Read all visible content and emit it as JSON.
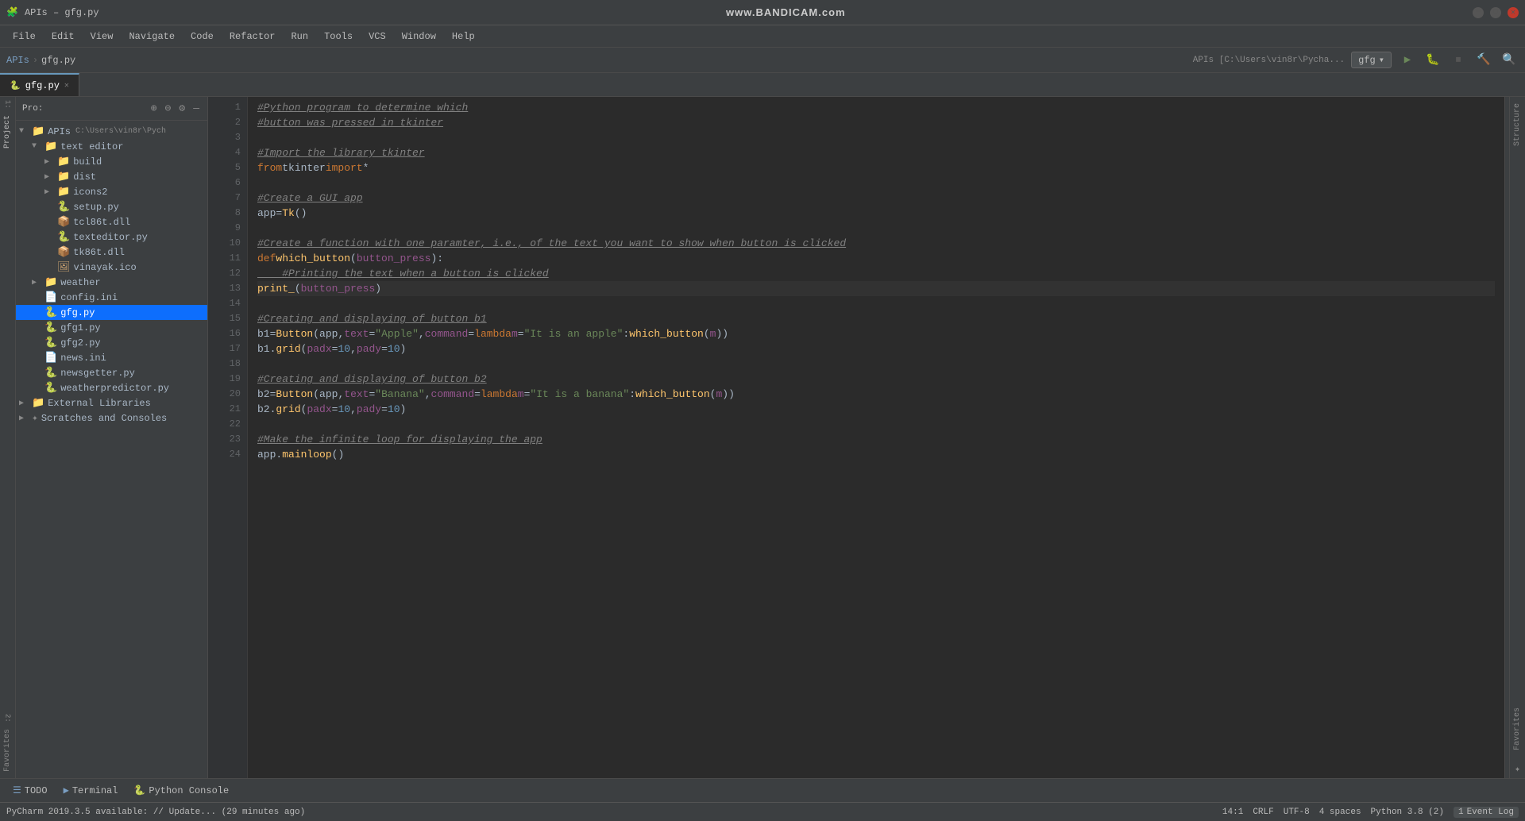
{
  "window": {
    "title": "APIs – gfg.py",
    "watermark": "www.BANDICAM.com"
  },
  "menubar": {
    "items": [
      "File",
      "Edit",
      "View",
      "Navigate",
      "Code",
      "Refactor",
      "Run",
      "Tools",
      "VCS",
      "Window",
      "Help"
    ]
  },
  "navbar": {
    "breadcrumb": [
      "APIs",
      "gfg.py"
    ],
    "run_config": "gfg",
    "path": "APIs [C:\\Users\\vin8r\\Pycha..."
  },
  "tabs": [
    {
      "label": "gfg.py",
      "active": true,
      "icon": "🐍"
    }
  ],
  "sidebar": {
    "title": "Pro:",
    "icons": [
      "⊕",
      "⊖",
      "⚙",
      "—"
    ],
    "tree": [
      {
        "level": 0,
        "type": "root",
        "label": "APIs",
        "sublabel": "C:\\Users\\vin8r\\Pych",
        "expanded": true,
        "arrow": "▼"
      },
      {
        "level": 1,
        "type": "folder",
        "label": "text editor",
        "expanded": true,
        "arrow": "▼"
      },
      {
        "level": 2,
        "type": "folder",
        "label": "build",
        "expanded": false,
        "arrow": "▶"
      },
      {
        "level": 2,
        "type": "folder",
        "label": "dist",
        "expanded": false,
        "arrow": "▶"
      },
      {
        "level": 2,
        "type": "folder",
        "label": "icons2",
        "expanded": false,
        "arrow": "▶"
      },
      {
        "level": 2,
        "type": "py",
        "label": "setup.py"
      },
      {
        "level": 2,
        "type": "dll",
        "label": "tcl86t.dll"
      },
      {
        "level": 2,
        "type": "py",
        "label": "texteditor.py"
      },
      {
        "level": 2,
        "type": "dll",
        "label": "tk86t.dll"
      },
      {
        "level": 2,
        "type": "ico",
        "label": "vinayak.ico"
      },
      {
        "level": 1,
        "type": "folder",
        "label": "weather",
        "expanded": false,
        "arrow": "▶"
      },
      {
        "level": 1,
        "type": "ini",
        "label": "config.ini"
      },
      {
        "level": 1,
        "type": "py",
        "label": "gfg.py",
        "selected": true
      },
      {
        "level": 1,
        "type": "py",
        "label": "gfg1.py"
      },
      {
        "level": 1,
        "type": "py",
        "label": "gfg2.py"
      },
      {
        "level": 1,
        "type": "ini",
        "label": "news.ini"
      },
      {
        "level": 1,
        "type": "py",
        "label": "newsgetter.py"
      },
      {
        "level": 1,
        "type": "py",
        "label": "weatherpredictor.py"
      },
      {
        "level": 0,
        "type": "folder",
        "label": "External Libraries",
        "expanded": false,
        "arrow": "▶"
      },
      {
        "level": 0,
        "type": "special",
        "label": "Scratches and Consoles",
        "expanded": false,
        "arrow": "▶"
      }
    ]
  },
  "editor": {
    "filename": "gfg.py",
    "lines": [
      {
        "num": 1,
        "content": "#Python_program to determine which",
        "type": "comment"
      },
      {
        "num": 2,
        "content": "#button was pressed in tkinter",
        "type": "comment"
      },
      {
        "num": 3,
        "content": "",
        "type": "blank"
      },
      {
        "num": 4,
        "content": "#Import the library tkinter",
        "type": "comment"
      },
      {
        "num": 5,
        "content": "from tkinter import *",
        "type": "code"
      },
      {
        "num": 6,
        "content": "",
        "type": "blank"
      },
      {
        "num": 7,
        "content": "#Create a GUI app",
        "type": "comment"
      },
      {
        "num": 8,
        "content": "app = Tk()",
        "type": "code"
      },
      {
        "num": 9,
        "content": "",
        "type": "blank"
      },
      {
        "num": 10,
        "content": "#Create a function with one paramter, i.e., of the text you want to show when button is clicked",
        "type": "comment"
      },
      {
        "num": 11,
        "content": "def which_button(button_press):",
        "type": "code"
      },
      {
        "num": 12,
        "content": "    #Printing the text when a button is clicked",
        "type": "comment-indented"
      },
      {
        "num": 13,
        "content": "    print_(button_press)",
        "type": "code-indented",
        "current": true
      },
      {
        "num": 14,
        "content": "",
        "type": "blank"
      },
      {
        "num": 15,
        "content": "#Creating and displaying of button b1",
        "type": "comment"
      },
      {
        "num": 16,
        "content": "b1 = Button(app, text=\"Apple\",command=lambda m=\"It is an apple\": which_button(m))",
        "type": "code"
      },
      {
        "num": 17,
        "content": "b1.grid(padx=10, pady=10)",
        "type": "code"
      },
      {
        "num": 18,
        "content": "",
        "type": "blank"
      },
      {
        "num": 19,
        "content": "#Creating and displaying of button b2",
        "type": "comment"
      },
      {
        "num": 20,
        "content": "b2 = Button(app, text=\"Banana\",command=lambda m=\"It is a banana\": which_button(m))",
        "type": "code"
      },
      {
        "num": 21,
        "content": "b2.grid(padx=10, pady=10)",
        "type": "code"
      },
      {
        "num": 22,
        "content": "",
        "type": "blank"
      },
      {
        "num": 23,
        "content": "#Make the infinite loop for displaying the app",
        "type": "comment"
      },
      {
        "num": 24,
        "content": "app.mainloop()",
        "type": "code"
      }
    ]
  },
  "bottom_tabs": [
    {
      "label": "TODO",
      "icon": "☰"
    },
    {
      "label": "Terminal",
      "icon": "▶"
    },
    {
      "label": "Python Console",
      "icon": "🐍"
    }
  ],
  "status_bar": {
    "update_msg": "PyCharm 2019.3.5 available: // Update... (29 minutes ago)",
    "position": "14:1",
    "line_ending": "CRLF",
    "encoding": "UTF-8",
    "indent": "4 spaces",
    "python_version": "Python 3.8 (2)",
    "event_log": "Event Log",
    "event_num": "1"
  },
  "structure_tabs": [
    "Structure",
    "Favorites"
  ],
  "colors": {
    "bg": "#2b2b2b",
    "sidebar_bg": "#3c3f41",
    "active_tab_indicator": "#6897bb",
    "selected_item": "#0d6efd",
    "comment": "#808080",
    "keyword": "#cc7832",
    "string": "#6a8759",
    "function": "#ffc66d",
    "param": "#94558d",
    "number": "#6897bb"
  }
}
